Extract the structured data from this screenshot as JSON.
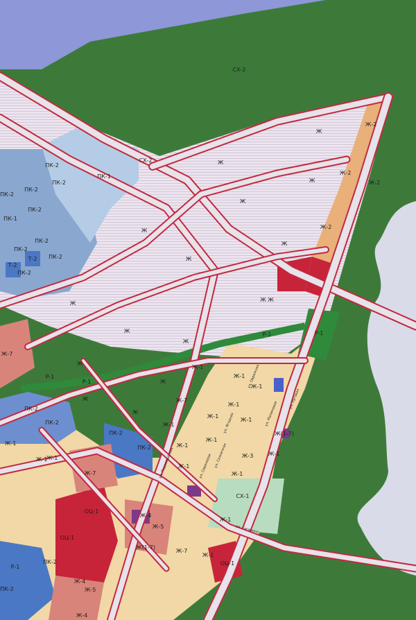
{
  "map": {
    "colors": {
      "sky": "#8e97d8",
      "water": "#d9dbe8",
      "agricultural": "#3d7a3a",
      "forest": "#356d34",
      "residential_planned": "#ece4ee",
      "residential": "#f1d8a6",
      "roads": "#e8e2ea",
      "road_edge": "#c2293f",
      "industrial": "#8aa7cf",
      "industrial_dark": "#4a78c4",
      "commercial": "#c7243a",
      "mixed": "#d9847a",
      "orange_strip": "#e9b07a",
      "park_green": "#2f8a3c",
      "sx1_green": "#b8dcc0",
      "purple": "#7a3a8a"
    },
    "zones": {
      "sx2_top": "СХ-2",
      "sx2_road": "СХ-2",
      "sx1": "СХ-1",
      "pk1": "ПК-1",
      "pk2_a": "ПК-2",
      "pk2_b": "ПК-2",
      "pk2_c": "ПК-2",
      "pk2_d": "ПК-2",
      "pk2_e": "ПК-2",
      "pk2_f": "ПК-2",
      "pk2_g": "ПК-2",
      "pk2_h": "ПК-2",
      "pk2_i": "ПК-2",
      "pk2_j": "ПК-2",
      "pk2_k": "ПК-2",
      "pk2_l": "ПК-2",
      "pk2_m": "ПК-2",
      "pk2_n": "ПК-2",
      "pk2_o": "ПК-2",
      "pk1_left": "ПК-1",
      "t2_a": "Т-2",
      "t2_b": "Т-2",
      "zh_a": "Ж",
      "zh_b": "Ж",
      "zh_c": "Ж",
      "zh_d": "Ж",
      "zh_e": "Ж",
      "zh_f": "Ж",
      "zh_g": "Ж Ж",
      "zh_h": "Ж",
      "zh_i": "Ж",
      "zh_j": "Ж",
      "zh_k": "Ж",
      "zh_l": "Ж",
      "zh_m": "Ж",
      "zh_n": "Ж",
      "zh_o": "Ж",
      "zh2_a": "Ж-2",
      "zh2_b": "Ж-2",
      "zh2_c": "Ж-2",
      "zh2_d": "Ж-2",
      "zh7_a": "Ж-7",
      "zh7_b": "Ж-7",
      "zh7_c": "Ж-7",
      "zh7_d": "Ж-7",
      "zh1_a": "Ж-1",
      "zh1_b": "Ж-1",
      "zh1_c": "Ж-1",
      "zh1_d": "Ж-1",
      "zh1_e": "Ж-1",
      "zh1_f": "Ж-1",
      "zh1_g": "Ж-1",
      "zh1_h": "Ж-1",
      "zh1_i": "Ж-1",
      "zh1_j": "Ж-1",
      "zh1_k": "Ж-1",
      "zh1_l": "Ж-1",
      "zh1_m": "Ж-1",
      "zh1_n": "Ж-1",
      "zh1_o": "Ж-1",
      "zh1_p": "Ж-1",
      "zh1_q": "Ж-1",
      "zh1_7_a": "Ж(1-7)",
      "zh1_7_b": "Ж(1-7)",
      "zh3": "Ж-3",
      "zh4_a": "Ж-4",
      "zh4_b": "Ж-4",
      "zh4_c": "Ж-4",
      "zh5_a": "Ж-5",
      "zh5_b": "Ж-5",
      "r1_a": "Р-1",
      "r1_b": "Р-1",
      "r1_c": "Р-1",
      "r1_d": "Р-1",
      "r1_e": "Р-1",
      "oc1_a": "ОЦ-1",
      "oc1_b": "ОЦ-1",
      "oc1_c": "ОЦ-1"
    },
    "streets": {
      "s1": "ул. Овражная",
      "s2": "ул. Малиновая",
      "s3": "ул. Солнечная",
      "s4": "ул. Сиреневая",
      "s5": "ул. Ягодная",
      "s6": "ул. Первомайская",
      "s7": "ул. Луговая",
      "s8": "ул. Гагарина"
    }
  }
}
